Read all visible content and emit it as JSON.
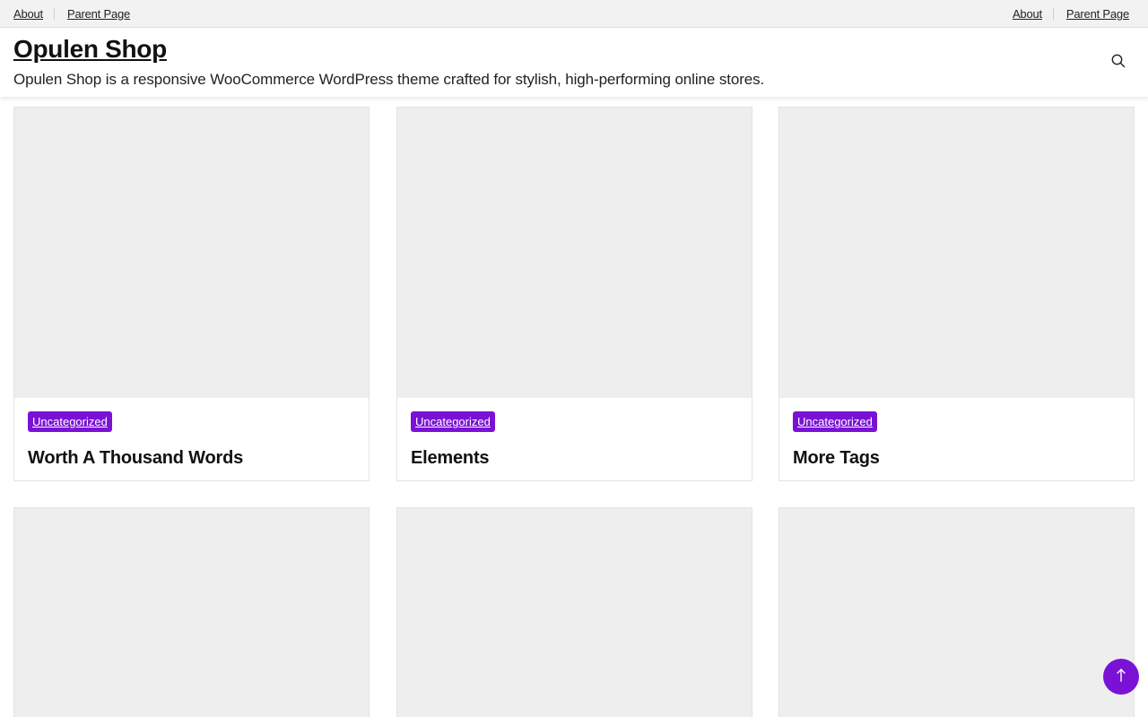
{
  "topbar": {
    "left_links": [
      "About",
      "Parent Page"
    ],
    "right_links": [
      "About",
      "Parent Page"
    ]
  },
  "header": {
    "site_title": "Opulen Shop",
    "tagline": "Opulen Shop is a responsive WooCommerce WordPress theme crafted for stylish, high-performing online stores.",
    "search_icon": "search-icon"
  },
  "posts": [
    {
      "category": "Uncategorized",
      "title": "Worth A Thousand Words"
    },
    {
      "category": "Uncategorized",
      "title": "Elements"
    },
    {
      "category": "Uncategorized",
      "title": "More Tags"
    }
  ],
  "scroll_top_icon": "arrow-up-icon",
  "colors": {
    "accent": "#7a12d6",
    "thumb_placeholder": "#eeeeee",
    "topbar_bg": "#f2f2f2"
  }
}
